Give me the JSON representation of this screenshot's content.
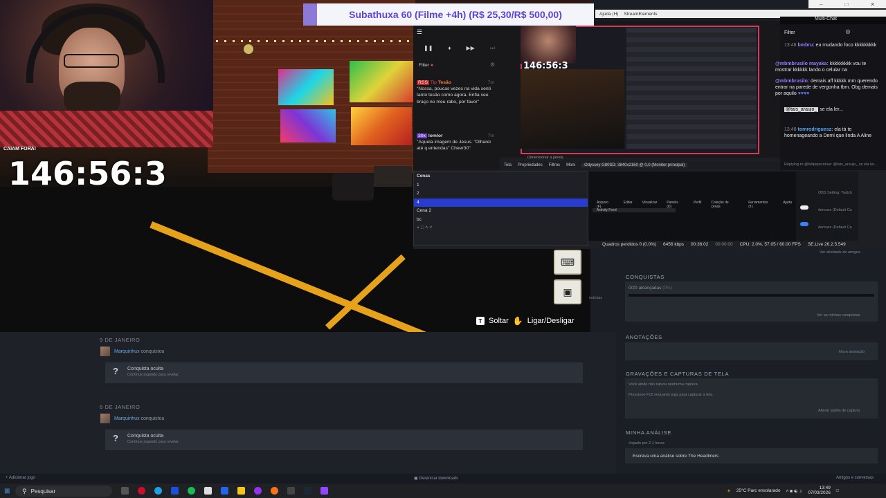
{
  "banner": {
    "text": "Subathuxa 60 (Filme +4h) (R$ 25,30/R$ 500,00)"
  },
  "stream": {
    "caption": "CAIAM FORA!",
    "timer": "146:56:3",
    "mini_timer": "146:56:3"
  },
  "game_hud": {
    "drop_key": "T",
    "drop_label": "Soltar",
    "toggle_label": "Ligar/Desligar",
    "news": "notícias"
  },
  "obs": {
    "menu_top": [
      "Ajuda (H)",
      "StreamElements"
    ],
    "chat_filter": "Filter",
    "chat_messages": [
      {
        "badges": "RSS",
        "tip": "Tip",
        "name": "Tesão",
        "time": "7m",
        "text": "\"Nossa, poucas vezes na vida senti tanto tesão como agora. Enfia seu braço no meu rabo, por favor\""
      },
      {
        "badges": "30x",
        "name": "lomlor",
        "time": "7m",
        "text": "\"Aquela imagem de Jesus. \"Olharei até q entendas\" Cheer30\""
      }
    ],
    "toolbar": [
      "Tela",
      "Propriedades",
      "Filtros",
      "Moni",
      "Odyssey G80SD: 3840x2160 @ 0,0 (Monitor principal)"
    ],
    "dimension_hint": "Dimensionar a janela",
    "scenes_title": "Cenas",
    "scenes": [
      "1",
      "2",
      "4",
      "Cena 2",
      "bc"
    ],
    "selected_scene_index": 2,
    "mixer_header": [
      "Arquivo (F)",
      "Editar",
      "Visualizar",
      "Painéis (D)",
      "Perfil",
      "Coleção de cenas",
      "Ferramentas (T)",
      "Ajuda"
    ],
    "mixer_sub": "Activity Feed",
    "status": {
      "dropped": "Quadros perdidos 0 (0.0%)",
      "bitrate": "6456 kbps",
      "rec": "00:36:02",
      "stream": "00:00:00",
      "cpu": "CPU: 2.0%, 57.05 / 60.00 FPS",
      "version": "SE.Live 26.2.5.549"
    },
    "sources": [
      "OBS Setting: Twitch",
      "demuxx (Default Ca",
      "demuxx (Default Ca"
    ]
  },
  "multichat": {
    "title": "Multi-Chat",
    "filter": "Filter",
    "messages": [
      {
        "time": "13:48",
        "user": "bmbru:",
        "text": "eu mudando foco kkkkkkkkk"
      },
      {
        "time": "",
        "user": "@mbmbrusilo mayaka:",
        "text": "kkkkkkkkk vou te mostrar kkkkkk lando o celular na"
      },
      {
        "time": "",
        "user": "@mbmbrusilo:",
        "text": "demais aff kkkkk mm querendo entrar na parede de vergonha tbm. Obg demais por aquilo"
      },
      {
        "time": "",
        "user": "@tais_araujo_",
        "text": "se ela ler..."
      },
      {
        "time": "13:48",
        "user": "tomrodriguesz:",
        "text": "ela tá te homenageando a Demi que linda A Aline"
      },
      {
        "time": "",
        "user": "",
        "text": "Replying to @felipepereiras: @tais_araujo_ se ela ler..."
      }
    ]
  },
  "steam": {
    "groups": [
      {
        "date": "9 DE JANEIRO",
        "user": "Marquinhux",
        "action": "conquistou",
        "title": "Conquista oculta",
        "sub": "Continue jogando para revelar."
      },
      {
        "date": "6 DE JANEIRO",
        "user": "Marquinhux",
        "action": "conquistou",
        "title": "Conquista oculta",
        "sub": "Continue jogando para revelar."
      }
    ],
    "friends_activity": "Ver atividade de amigos",
    "achievements": {
      "title": "CONQUISTAS",
      "progress": "0/20 alcançadas",
      "pct": "(0%)",
      "progress_value": 0,
      "link": "Ver as minhas conquistas"
    },
    "notes": {
      "title": "ANOTAÇÕES",
      "link": "Nova anotação"
    },
    "captures": {
      "title": "GRAVAÇÕES E CAPTURAS DE TELA",
      "line1": "Você ainda não salvou nenhuma captura",
      "line2": "Pressione F12 enquanto joga para capturar a tela.",
      "link": "Alterar atalho de captura"
    },
    "review": {
      "title": "MINHA ANÁLISE",
      "played": "Jogado por 2,1 horas",
      "cta": "Escreva uma análise sobre The Headliners"
    },
    "footer": {
      "add_game": "Adicionar jogo",
      "downloads": "Gerenciar downloads",
      "friends": "Amigos e conversas"
    }
  },
  "taskbar": {
    "search_placeholder": "Pesquisar",
    "weather": "25°C Parc ensolarado",
    "time": "13:49",
    "date": "07/03/2026"
  }
}
